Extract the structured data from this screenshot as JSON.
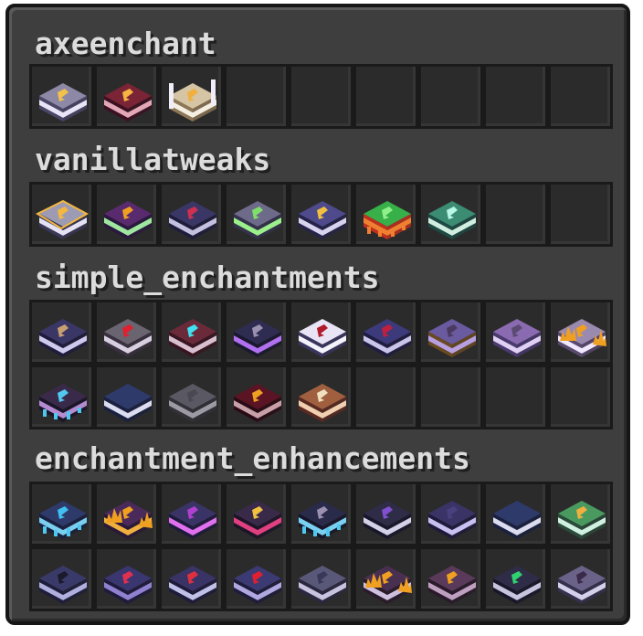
{
  "panel": {
    "sections": [
      {
        "title": "axeenchant",
        "books": [
          {
            "name": "book-icon",
            "cover": "#8d88a6",
            "side": "#4a4668",
            "page": "#e9e4f7",
            "glyph": "#f2c14a",
            "accent": "none"
          },
          {
            "name": "book-icon",
            "cover": "#7a2436",
            "side": "#3c1020",
            "page": "#e3a8b8",
            "glyph": "#f6b540",
            "accent": "none"
          },
          {
            "name": "book-icon",
            "cover": "#d6c5a4",
            "side": "#8e7756",
            "page": "#f5efe2",
            "glyph": "#f0b040",
            "accent": "pillars"
          },
          null,
          null,
          null,
          null,
          null,
          null
        ]
      },
      {
        "title": "vanillatweaks",
        "books": [
          {
            "name": "book-icon",
            "cover": "#9d9ab3",
            "side": "#3a3758",
            "page": "#e6e2f5",
            "glyph": "#f2b840",
            "accent": "outline-gold"
          },
          {
            "name": "book-icon",
            "cover": "#5a2a6e",
            "side": "#2a1840",
            "page": "#9fe6a0",
            "glyph": "#f0a020",
            "accent": "none"
          },
          {
            "name": "book-icon",
            "cover": "#3a3766",
            "side": "#1e1c3c",
            "page": "#c4c0e0",
            "glyph": "#d03050",
            "accent": "none"
          },
          {
            "name": "book-icon",
            "cover": "#6e6a8a",
            "side": "#35324e",
            "page": "#9cf08c",
            "glyph": "#7ee06a",
            "accent": "none"
          },
          {
            "name": "book-icon",
            "cover": "#4e4a8c",
            "side": "#25234a",
            "page": "#d8d4f0",
            "glyph": "#f2c040",
            "accent": "none"
          },
          {
            "name": "book-icon",
            "cover": "#38b04a",
            "side": "#c03020",
            "page": "#f08030",
            "glyph": "#8ff08a",
            "accent": "drip-orange"
          },
          {
            "name": "book-icon",
            "cover": "#3c8c74",
            "side": "#1e4a44",
            "page": "#cfeee0",
            "glyph": "#b8f6e6",
            "accent": "none"
          },
          null,
          null
        ]
      },
      {
        "title": "simple_enchantments",
        "books": [
          {
            "name": "book-icon",
            "cover": "#3a3766",
            "side": "#1e1c3c",
            "page": "#cfc9ee",
            "glyph": "#c8a070",
            "accent": "none"
          },
          {
            "name": "book-icon",
            "cover": "#6a6470",
            "side": "#3a3040",
            "page": "#d8d0e0",
            "glyph": "#e02030",
            "accent": "none"
          },
          {
            "name": "book-icon",
            "cover": "#6a2a3a",
            "side": "#3a1422",
            "page": "#d8c0d0",
            "glyph": "#40e0f0",
            "accent": "none"
          },
          {
            "name": "book-icon",
            "cover": "#2e2c50",
            "side": "#1a1830",
            "page": "#b070f0",
            "glyph": "#9a90b0",
            "accent": "none"
          },
          {
            "name": "book-icon",
            "cover": "#e8e4f6",
            "side": "#3a3660",
            "page": "#f4f2fc",
            "glyph": "#b01a2a",
            "accent": "none"
          },
          {
            "name": "book-icon",
            "cover": "#3c3a7a",
            "side": "#1e1c40",
            "page": "#c8c4ea",
            "glyph": "#c02040",
            "accent": "none"
          },
          {
            "name": "book-icon",
            "cover": "#6a5aa0",
            "side": "#6a4a20",
            "page": "#b8a0e0",
            "glyph": "#4a3a60",
            "accent": "none"
          },
          {
            "name": "book-icon",
            "cover": "#8a6ab0",
            "side": "#4a3a70",
            "page": "#e0d0f4",
            "glyph": "#5a4a70",
            "accent": "none"
          },
          {
            "name": "book-icon",
            "cover": "#9a8ab0",
            "side": "#5a4a70",
            "page": "#f0e8ff",
            "glyph": "#f0a020",
            "accent": "flames"
          },
          {
            "name": "book-icon",
            "cover": "#3a2a4a",
            "side": "#1a1428",
            "page": "#b48ad0",
            "glyph": "#50c8f0",
            "accent": "drip-cyan"
          },
          {
            "name": "book-icon",
            "cover": "#2e3a6a",
            "side": "#1a2040",
            "page": "#dcdcf0",
            "glyph": "#2e3a6a",
            "accent": "none"
          },
          {
            "name": "book-icon",
            "cover": "#5a5862",
            "side": "#333038",
            "page": "#9c9aa4",
            "glyph": "#4a4850",
            "accent": "none"
          },
          {
            "name": "book-icon",
            "cover": "#5a1424",
            "side": "#2a0a14",
            "page": "#c8a0a8",
            "glyph": "#f0a020",
            "accent": "none"
          },
          {
            "name": "book-icon",
            "cover": "#a06040",
            "side": "#5a2a20",
            "page": "#f0d0b0",
            "glyph": "#f0e0c0",
            "accent": "none"
          },
          null,
          null,
          null,
          null
        ]
      },
      {
        "title": "enchantment_enhancements",
        "books": [
          {
            "name": "book-icon",
            "cover": "#2e3a6a",
            "side": "#1a2040",
            "page": "#7acff0",
            "glyph": "#40c0f0",
            "accent": "drip-cyan"
          },
          {
            "name": "book-icon",
            "cover": "#4a2a5a",
            "side": "#2a1838",
            "page": "#f0b040",
            "glyph": "#f0a020",
            "accent": "flames"
          },
          {
            "name": "book-icon",
            "cover": "#3a3466",
            "side": "#1e1a3c",
            "page": "#e070f0",
            "glyph": "#b040d0",
            "accent": "none"
          },
          {
            "name": "book-icon",
            "cover": "#3a2a4a",
            "side": "#1e1428",
            "page": "#e04080",
            "glyph": "#f0c040",
            "accent": "none"
          },
          {
            "name": "book-icon",
            "cover": "#2a2a4a",
            "side": "#16162a",
            "page": "#7ad0f0",
            "glyph": "#9a90b0",
            "accent": "drip-cyan"
          },
          {
            "name": "book-icon",
            "cover": "#2e2c46",
            "side": "#18162a",
            "page": "#d4d0e8",
            "glyph": "#8050d0",
            "accent": "none"
          },
          {
            "name": "book-icon",
            "cover": "#3a3466",
            "side": "#1e1a3c",
            "page": "#c8c0f0",
            "glyph": "#4a4080",
            "accent": "none"
          },
          {
            "name": "book-icon",
            "cover": "#2e3a6a",
            "side": "#1a2040",
            "page": "#dcdcf0",
            "glyph": "#2e3a6a",
            "accent": "none"
          },
          {
            "name": "book-icon",
            "cover": "#4a9a60",
            "side": "#2a4a3a",
            "page": "#d0f0e0",
            "glyph": "#f0b040",
            "accent": "none"
          },
          {
            "name": "book-icon",
            "cover": "#3a3a6a",
            "side": "#1e1e3c",
            "page": "#b0b0e0",
            "glyph": "#1a1a2a",
            "accent": "none"
          },
          {
            "name": "book-icon",
            "cover": "#3a3670",
            "side": "#1e1a3c",
            "page": "#9080d0",
            "glyph": "#e03050",
            "accent": "none"
          },
          {
            "name": "book-icon",
            "cover": "#3a3466",
            "side": "#1e1a3c",
            "page": "#c0c0e8",
            "glyph": "#e03040",
            "accent": "none"
          },
          {
            "name": "book-icon",
            "cover": "#3c3a72",
            "side": "#1e1c3c",
            "page": "#b0a8e0",
            "glyph": "#e02030",
            "accent": "none"
          },
          {
            "name": "book-icon",
            "cover": "#5a5878",
            "side": "#2a2840",
            "page": "#c8c4e0",
            "glyph": "#3a3858",
            "accent": "none"
          },
          {
            "name": "book-icon",
            "cover": "#4a3050",
            "side": "#2a1a2a",
            "page": "#d0c0e0",
            "glyph": "#f0a020",
            "accent": "flames"
          },
          {
            "name": "book-icon",
            "cover": "#5a3a5a",
            "side": "#2a1a2a",
            "page": "#c0a0c0",
            "glyph": "#f0a020",
            "accent": "none"
          },
          {
            "name": "book-icon",
            "cover": "#2e2c46",
            "side": "#18162a",
            "page": "#c8c4e0",
            "glyph": "#30d070",
            "accent": "none"
          },
          {
            "name": "book-icon",
            "cover": "#6a6288",
            "side": "#35304e",
            "page": "#d4d0ec",
            "glyph": "#3a2a4a",
            "accent": "none"
          }
        ]
      }
    ]
  }
}
